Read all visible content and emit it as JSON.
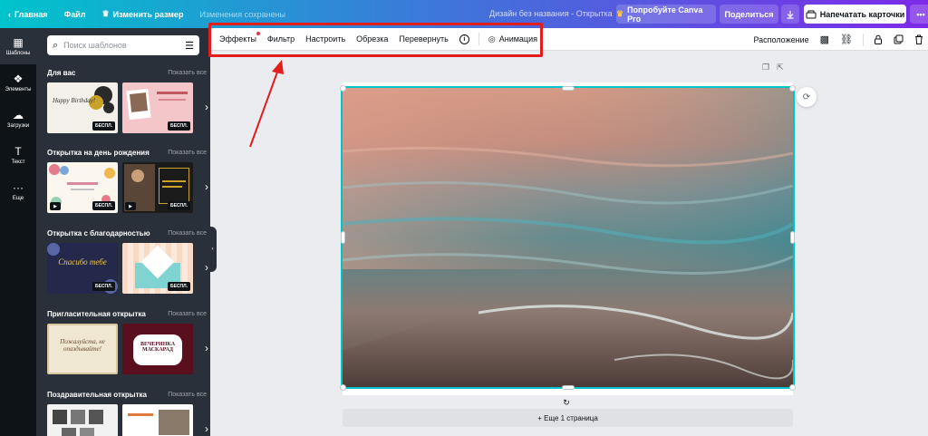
{
  "topbar": {
    "home_label": "Главная",
    "file_label": "Файл",
    "resize_label": "Изменить размер",
    "saved_status": "Изменения сохранены",
    "design_title": "Дизайн без названия - Открытка",
    "pro_label": "Попробуйте Canva Pro",
    "share_label": "Поделиться",
    "print_label": "Напечатать карточки"
  },
  "rail": {
    "items": [
      {
        "label": "Шаблоны",
        "icon": "layout-icon"
      },
      {
        "label": "Элементы",
        "icon": "shapes-icon"
      },
      {
        "label": "Загрузки",
        "icon": "upload-icon"
      },
      {
        "label": "Текст",
        "icon": "text-icon"
      },
      {
        "label": "Еще",
        "icon": "more-icon"
      }
    ]
  },
  "panel": {
    "search_placeholder": "Поиск шаблонов",
    "sections": [
      {
        "title": "Для вас",
        "show_all": "Показать все"
      },
      {
        "title": "Открытка на день рождения",
        "show_all": "Показать все"
      },
      {
        "title": "Открытка с благодарностью",
        "show_all": "Показать все"
      },
      {
        "title": "Пригласительная открытка",
        "show_all": "Показать все"
      },
      {
        "title": "Поздравительная открытка",
        "show_all": "Показать все"
      }
    ],
    "badge": "БЕСПЛ.",
    "thumb_texts": {
      "birthday": "Happy Birthday!",
      "spasibo": "Спасибо тебе",
      "invite": "Пожалуйста, не опаздывайте!",
      "masquerade": "ВЕЧЕРИНКА МАСКАРАД"
    }
  },
  "toolbar": {
    "effects": "Эффекты",
    "filter": "Фильтр",
    "adjust": "Настроить",
    "crop": "Обрезка",
    "flip": "Перевернуть",
    "animation": "Анимация",
    "position": "Расположение"
  },
  "canvas": {
    "add_page": "+ Еще 1 страница"
  },
  "colors": {
    "accent": "#00c4cc",
    "highlight": "#e11d1d",
    "brand_purple": "#7d2ae8"
  }
}
